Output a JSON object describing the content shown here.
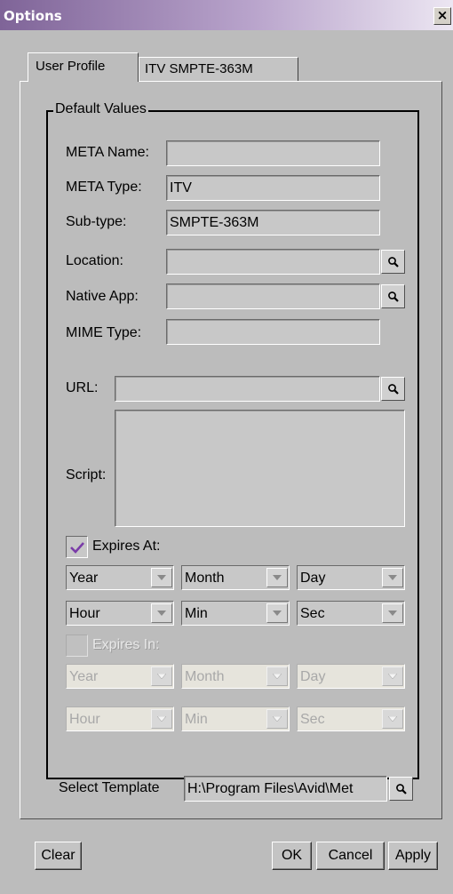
{
  "window": {
    "title": "Options",
    "close_glyph": "×"
  },
  "tabs": [
    {
      "label": "User Profile",
      "active": true
    },
    {
      "label": "ITV SMPTE-363M",
      "active": false
    }
  ],
  "group": {
    "legend": "Default Values"
  },
  "fields": {
    "meta_name": {
      "label": "META Name:",
      "value": ""
    },
    "meta_type": {
      "label": "META Type:",
      "value": "ITV"
    },
    "sub_type": {
      "label": "Sub-type:",
      "value": "SMPTE-363M"
    },
    "location": {
      "label": "Location:",
      "value": ""
    },
    "native_app": {
      "label": "Native App:",
      "value": ""
    },
    "mime_type": {
      "label": "MIME Type:",
      "value": ""
    },
    "url": {
      "label": "URL:",
      "value": ""
    },
    "script": {
      "label": "Script:",
      "value": ""
    }
  },
  "expires_at": {
    "label": "Expires At:",
    "checked": true,
    "year": "Year",
    "month": "Month",
    "day": "Day",
    "hour": "Hour",
    "min": "Min",
    "sec": "Sec"
  },
  "expires_in": {
    "label": "Expires In:",
    "checked": false,
    "enabled": false,
    "year": "Year",
    "month": "Month",
    "day": "Day",
    "hour": "Hour",
    "min": "Min",
    "sec": "Sec"
  },
  "template": {
    "label": "Select Template",
    "value": "H:\\Program Files\\Avid\\Met"
  },
  "buttons": {
    "clear": "Clear",
    "ok": "OK",
    "cancel": "Cancel",
    "apply": "Apply"
  },
  "colors": {
    "title_bar_start": "#7f6498",
    "title_bar_end": "#ece6f2",
    "dialog_bg": "#bcbcbc",
    "check_accent": "#7a3ca8"
  },
  "icons": {
    "search": "magnifier-icon",
    "dropdown": "chevron-down-icon",
    "check": "checkmark-icon"
  }
}
